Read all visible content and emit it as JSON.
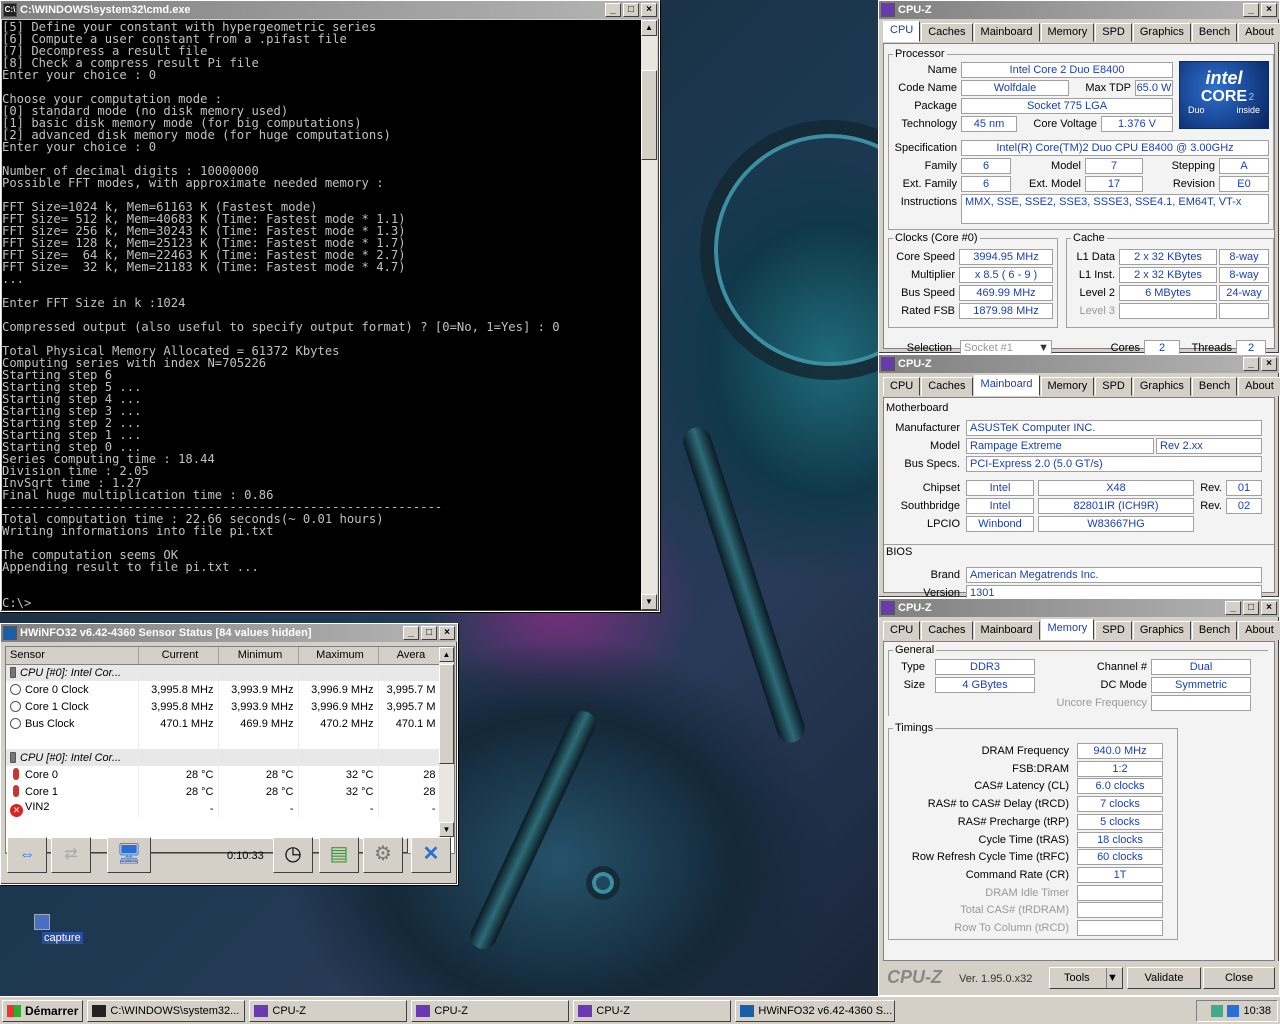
{
  "cmd": {
    "title": "C:\\WINDOWS\\system32\\cmd.exe",
    "lines": [
      "[5] Define your constant with hypergeometric series",
      "[6] Compute a user constant from a .pifast file",
      "[7] Decompress a result file",
      "[8] Check a compress result Pi file",
      "Enter your choice : 0",
      "",
      "Choose your computation mode :",
      "[0] standard mode (no disk memory used)",
      "[1] basic disk memory mode (for big computations)",
      "[2] advanced disk memory mode (for huge computations)",
      "Enter your choice : 0",
      "",
      "Number of decimal digits : 10000000",
      "Possible FFT modes, with approximate needed memory :",
      "",
      "FFT Size=1024 k, Mem=61163 K (Fastest mode)",
      "FFT Size= 512 k, Mem=40683 K (Time: Fastest mode * 1.1)",
      "FFT Size= 256 k, Mem=30243 K (Time: Fastest mode * 1.3)",
      "FFT Size= 128 k, Mem=25123 K (Time: Fastest mode * 1.7)",
      "FFT Size=  64 k, Mem=22463 K (Time: Fastest mode * 2.7)",
      "FFT Size=  32 k, Mem=21183 K (Time: Fastest mode * 4.7)",
      "...",
      "",
      "Enter FFT Size in k :1024",
      "",
      "Compressed output (also useful to specify output format) ? [0=No, 1=Yes] : 0",
      "",
      "Total Physical Memory Allocated = 61372 Kbytes",
      "Computing series with index N=705226",
      "Starting step 6",
      "Starting step 5 ...",
      "Starting step 4 ...",
      "Starting step 3 ...",
      "Starting step 2 ...",
      "Starting step 1 ...",
      "Starting step 0 ...",
      "Series computing time : 18.44",
      "Division time : 2.05",
      "InvSqrt time : 1.27",
      "Final huge multiplication time : 0.86",
      "------------------------------------------------------------",
      "Total computation time : 22.66 seconds(~ 0.01 hours)",
      "Writing informations into file pi.txt",
      "",
      "The computation seems OK",
      "Appending result to file pi.txt ...",
      "",
      "",
      "C:\\>"
    ]
  },
  "hwinfo": {
    "title": "HWiNFO32 v6.42-4360 Sensor Status [84 values hidden]",
    "columns": [
      "Sensor",
      "Current",
      "Minimum",
      "Maximum",
      "Avera"
    ],
    "rows": [
      {
        "type": "group",
        "sensor": "CPU [#0]: Intel Cor..."
      },
      {
        "type": "clock",
        "sensor": "Core 0 Clock",
        "current": "3,995.8 MHz",
        "minimum": "3,993.9 MHz",
        "maximum": "3,996.9 MHz",
        "average": "3,995.7 M"
      },
      {
        "type": "clock",
        "sensor": "Core 1 Clock",
        "current": "3,995.8 MHz",
        "minimum": "3,993.9 MHz",
        "maximum": "3,996.9 MHz",
        "average": "3,995.7 M"
      },
      {
        "type": "clock",
        "sensor": "Bus Clock",
        "current": "470.1 MHz",
        "minimum": "469.9 MHz",
        "maximum": "470.2 MHz",
        "average": "470.1 M"
      },
      {
        "type": "blank",
        "sensor": ""
      },
      {
        "type": "group",
        "sensor": "CPU [#0]: Intel Cor..."
      },
      {
        "type": "temp",
        "sensor": "Core 0",
        "current": "28 °C",
        "minimum": "28 °C",
        "maximum": "32 °C",
        "average": "28"
      },
      {
        "type": "temp",
        "sensor": "Core 1",
        "current": "28 °C",
        "minimum": "28 °C",
        "maximum": "32 °C",
        "average": "28"
      },
      {
        "type": "error",
        "sensor": "VIN2",
        "current": "-",
        "minimum": "-",
        "maximum": "-",
        "average": "-"
      }
    ],
    "elapsed": "0:10:33"
  },
  "cpuz_cpu": {
    "title": "CPU-Z",
    "tabs": [
      "CPU",
      "Caches",
      "Mainboard",
      "Memory",
      "SPD",
      "Graphics",
      "Bench",
      "About"
    ],
    "processor_label": "Processor",
    "name_label": "Name",
    "name": "Intel Core 2 Duo E8400",
    "codename_label": "Code Name",
    "codename": "Wolfdale",
    "maxtdp_label": "Max TDP",
    "maxtdp": "65.0 W",
    "package_label": "Package",
    "package": "Socket 775 LGA",
    "technology_label": "Technology",
    "technology": "45 nm",
    "corevoltage_label": "Core Voltage",
    "corevoltage": "1.376 V",
    "spec_label": "Specification",
    "spec": "Intel(R) Core(TM)2 Duo CPU     E8400  @ 3.00GHz",
    "family_label": "Family",
    "family": "6",
    "model_label": "Model",
    "model": "7",
    "stepping_label": "Stepping",
    "stepping": "A",
    "extfamily_label": "Ext. Family",
    "extfamily": "6",
    "extmodel_label": "Ext. Model",
    "extmodel": "17",
    "revision_label": "Revision",
    "revision": "E0",
    "instructions_label": "Instructions",
    "instructions": "MMX, SSE, SSE2, SSE3, SSSE3, SSE4.1, EM64T, VT-x",
    "intel_logo": {
      "brand": "intel",
      "line": "CORE",
      "sub": "Duo",
      "tag": "inside",
      "num": "2"
    },
    "clocks_label": "Clocks (Core #0)",
    "corespeed_label": "Core Speed",
    "corespeed": "3994.95 MHz",
    "multiplier_label": "Multiplier",
    "multiplier": "x 8.5 ( 6 - 9 )",
    "busspeed_label": "Bus Speed",
    "busspeed": "469.99 MHz",
    "ratedfsb_label": "Rated FSB",
    "ratedfsb": "1879.98 MHz",
    "cache_label": "Cache",
    "l1d_label": "L1 Data",
    "l1d": "2 x 32 KBytes",
    "l1d_way": "8-way",
    "l1i_label": "L1 Inst.",
    "l1i": "2 x 32 KBytes",
    "l1i_way": "8-way",
    "l2_label": "Level 2",
    "l2": "6 MBytes",
    "l2_way": "24-way",
    "l3_label": "Level 3",
    "selection_label": "Selection",
    "selection": "Socket #1",
    "cores_label": "Cores",
    "cores": "2",
    "threads_label": "Threads",
    "threads": "2"
  },
  "cpuz_mb": {
    "title": "CPU-Z",
    "motherboard_label": "Motherboard",
    "manufacturer_label": "Manufacturer",
    "manufacturer": "ASUSTeK Computer INC.",
    "model_label": "Model",
    "model": "Rampage Extreme",
    "model_rev": "Rev 2.xx",
    "busspecs_label": "Bus Specs.",
    "busspecs": "PCI-Express 2.0 (5.0 GT/s)",
    "chipset_label": "Chipset",
    "chipset_vendor": "Intel",
    "chipset_model": "X48",
    "chipset_rev_label": "Rev.",
    "chipset_rev": "01",
    "southbridge_label": "Southbridge",
    "sb_vendor": "Intel",
    "sb_model": "82801IR (ICH9R)",
    "sb_rev_label": "Rev.",
    "sb_rev": "02",
    "lpcio_label": "LPCIO",
    "lpcio_vendor": "Winbond",
    "lpcio_model": "W83667HG",
    "bios_label": "BIOS",
    "brand_label": "Brand",
    "brand": "American Megatrends Inc.",
    "version_label": "Version",
    "version": "1301"
  },
  "cpuz_mem": {
    "title": "CPU-Z",
    "general_label": "General",
    "type_label": "Type",
    "type": "DDR3",
    "channel_label": "Channel #",
    "channel": "Dual",
    "size_label": "Size",
    "size": "4 GBytes",
    "dcmode_label": "DC Mode",
    "dcmode": "Symmetric",
    "uncore_label": "Uncore Frequency",
    "timings_label": "Timings",
    "timings": [
      {
        "label": "DRAM Frequency",
        "value": "940.0 MHz"
      },
      {
        "label": "FSB:DRAM",
        "value": "1:2"
      },
      {
        "label": "CAS# Latency (CL)",
        "value": "6.0 clocks"
      },
      {
        "label": "RAS# to CAS# Delay (tRCD)",
        "value": "7 clocks"
      },
      {
        "label": "RAS# Precharge (tRP)",
        "value": "5 clocks"
      },
      {
        "label": "Cycle Time (tRAS)",
        "value": "18 clocks"
      },
      {
        "label": "Row Refresh Cycle Time (tRFC)",
        "value": "60 clocks"
      },
      {
        "label": "Command Rate (CR)",
        "value": "1T"
      },
      {
        "label": "DRAM Idle Timer",
        "value": ""
      },
      {
        "label": "Total CAS# (tRDRAM)",
        "value": ""
      },
      {
        "label": "Row To Column (tRCD)",
        "value": ""
      }
    ],
    "brand": "CPU-Z",
    "version": "Ver. 1.95.0.x32",
    "tools_label": "Tools",
    "validate_label": "Validate",
    "close_label": "Close"
  },
  "desktop": {
    "icon_label": "capture"
  },
  "taskbar": {
    "start_label": "Démarrer",
    "tasks": [
      "C:\\WINDOWS\\system32...",
      "CPU-Z",
      "CPU-Z",
      "CPU-Z",
      "HWiNFO32 v6.42-4360 S..."
    ],
    "clock": "10:38"
  }
}
